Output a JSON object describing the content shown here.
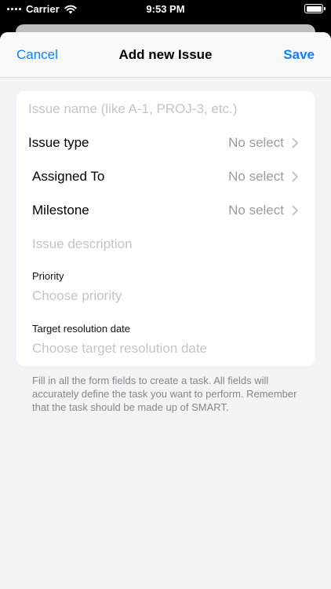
{
  "status_bar": {
    "carrier": "Carrier",
    "time": "9:53 PM"
  },
  "nav": {
    "cancel_label": "Cancel",
    "title": "Add new Issue",
    "save_label": "Save"
  },
  "form": {
    "issue_name_placeholder": "Issue name (like A-1, PROJ-3, etc.)",
    "issue_type": {
      "label": "Issue type",
      "value": "No select"
    },
    "assigned_to": {
      "label": "Assigned To",
      "value": "No select"
    },
    "milestone": {
      "label": "Milestone",
      "value": "No select"
    },
    "description_placeholder": "Issue description",
    "priority": {
      "label": "Priority",
      "placeholder": "Choose priority"
    },
    "target_date": {
      "label": "Target resolution date",
      "placeholder": "Choose target resolution date"
    }
  },
  "footer_note": "Fill in all the form fields to create a task. All fields will accurately define the task you want to perform. Remember that the task should be made up of SMART.",
  "colors": {
    "accent": "#147efb",
    "placeholder": "#c4c4c6",
    "secondary_text": "#9b9ba0",
    "background": "#f2f2f7"
  },
  "icons": [
    "signal-dots-icon",
    "wifi-icon",
    "battery-icon",
    "chevron-right-icon"
  ]
}
